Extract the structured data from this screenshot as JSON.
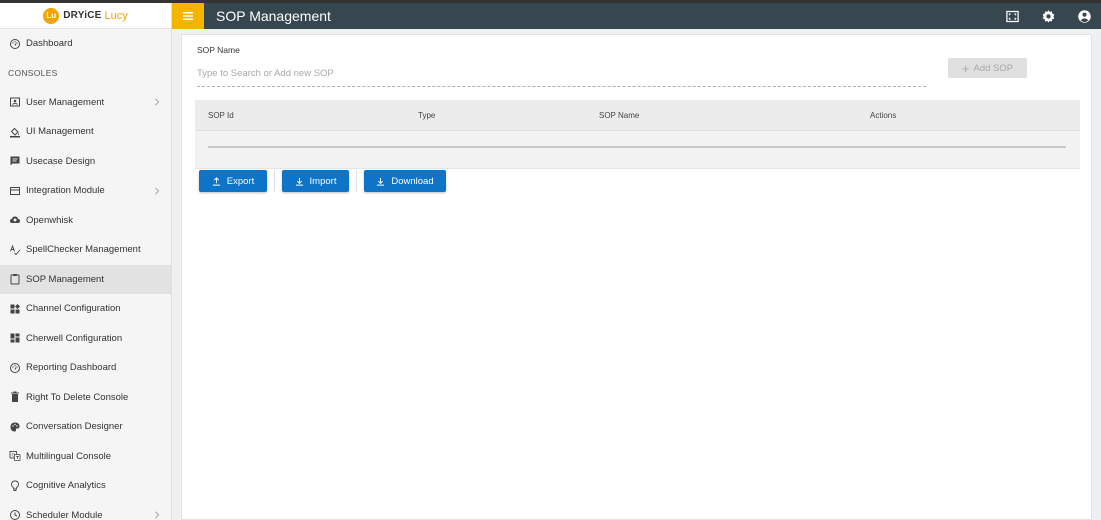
{
  "brand": {
    "badge": "Lu",
    "name": "DRYiCE",
    "product": "Lucy",
    "accent": "#f5a300"
  },
  "header": {
    "title": "SOP Management",
    "bg": "#37474f",
    "menu_bg": "#f5b400"
  },
  "sidebar": {
    "section_label": "CONSOLES",
    "items": [
      {
        "label": "Dashboard",
        "icon": "dashboard-icon"
      },
      {
        "label": "User Management",
        "icon": "user-card-icon",
        "chevron": true
      },
      {
        "label": "UI Management",
        "icon": "paint-bucket-icon"
      },
      {
        "label": "Usecase Design",
        "icon": "chat-box-icon"
      },
      {
        "label": "Integration Module",
        "icon": "integration-icon",
        "chevron": true
      },
      {
        "label": "Openwhisk",
        "icon": "cloud-icon"
      },
      {
        "label": "SpellChecker Management",
        "icon": "spellcheck-icon"
      },
      {
        "label": "SOP Management",
        "icon": "clipboard-icon",
        "active": true
      },
      {
        "label": "Channel Configuration",
        "icon": "widgets-icon"
      },
      {
        "label": "Cherwell Configuration",
        "icon": "dashboard-grid-icon"
      },
      {
        "label": "Reporting Dashboard",
        "icon": "speedometer-icon"
      },
      {
        "label": "Right To Delete Console",
        "icon": "trash-icon"
      },
      {
        "label": "Conversation Designer",
        "icon": "palette-icon"
      },
      {
        "label": "Multilingual Console",
        "icon": "translate-icon"
      },
      {
        "label": "Cognitive Analytics",
        "icon": "lightbulb-icon"
      },
      {
        "label": "Scheduler Module",
        "icon": "clock-icon",
        "chevron": true
      }
    ]
  },
  "form": {
    "label": "SOP Name",
    "placeholder": "Type to Search or Add new SOP",
    "add_button": "Add SOP"
  },
  "table": {
    "columns": [
      "SOP Id",
      "Type",
      "SOP Name",
      "Actions"
    ],
    "rows": []
  },
  "actions": {
    "export": "Export",
    "import": "Import",
    "download": "Download",
    "color": "#0d74c8"
  }
}
